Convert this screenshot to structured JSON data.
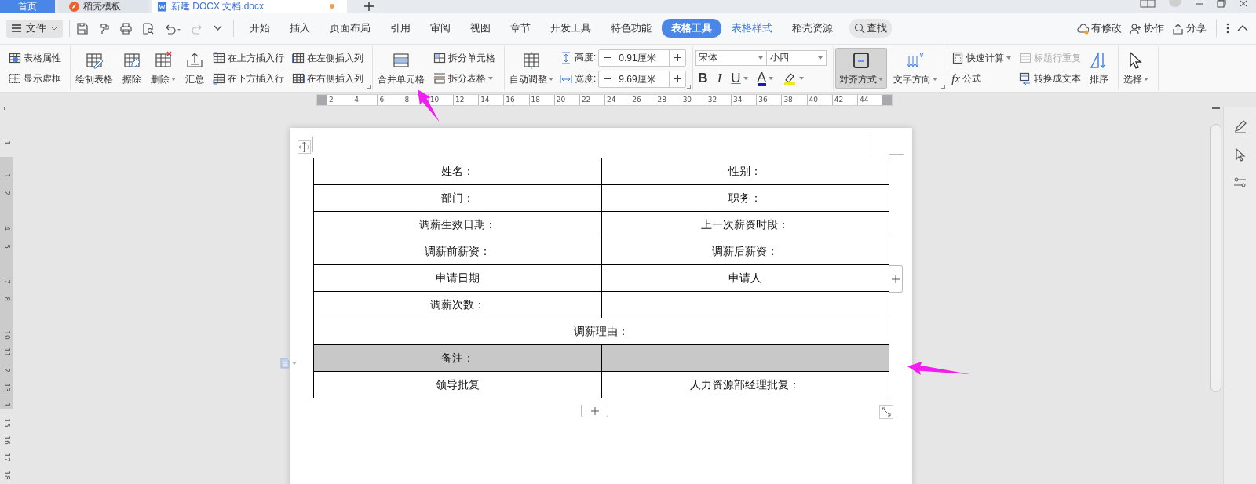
{
  "tabs": [
    {
      "label": "首页",
      "kind": "home",
      "selected": false,
      "modified": false
    },
    {
      "label": "稻壳模板",
      "kind": "template",
      "selected": false,
      "modified": false
    },
    {
      "label": "新建 DOCX 文档.docx",
      "kind": "document",
      "selected": true,
      "modified": true
    }
  ],
  "menu": {
    "file_button": "文件",
    "tabs": [
      {
        "label": "开始",
        "selected": false,
        "contextual": false
      },
      {
        "label": "插入",
        "selected": false,
        "contextual": false
      },
      {
        "label": "页面布局",
        "selected": false,
        "contextual": false
      },
      {
        "label": "引用",
        "selected": false,
        "contextual": false
      },
      {
        "label": "审阅",
        "selected": false,
        "contextual": false
      },
      {
        "label": "视图",
        "selected": false,
        "contextual": false
      },
      {
        "label": "章节",
        "selected": false,
        "contextual": false
      },
      {
        "label": "开发工具",
        "selected": false,
        "contextual": false
      },
      {
        "label": "特色功能",
        "selected": false,
        "contextual": false
      },
      {
        "label": "表格工具",
        "selected": true,
        "contextual": true
      },
      {
        "label": "表格样式",
        "selected": false,
        "contextual": true
      },
      {
        "label": "稻壳资源",
        "selected": false,
        "contextual": false
      }
    ],
    "search": "查找",
    "actions": [
      "有修改",
      "协作",
      "分享"
    ]
  },
  "ribbon": [
    {
      "launcher": false,
      "columns": [
        {
          "kind": "stack",
          "items": [
            {
              "label": "表格属性",
              "dropdown": false,
              "disabled": false
            },
            {
              "label": "显示虚框",
              "dropdown": false,
              "disabled": false
            }
          ]
        }
      ]
    },
    {
      "launcher": true,
      "columns": [
        {
          "kind": "large",
          "label": "绘制表格",
          "dropdown": false,
          "pressed": false
        },
        {
          "kind": "large",
          "label": "擦除",
          "dropdown": false,
          "pressed": false
        },
        {
          "kind": "large",
          "label": "删除",
          "dropdown": true,
          "pressed": false
        },
        {
          "kind": "large",
          "label": "汇总",
          "dropdown": false,
          "pressed": false
        },
        {
          "kind": "stack",
          "items": [
            {
              "label": "在上方插入行",
              "dropdown": false,
              "disabled": false
            },
            {
              "label": "在下方插入行",
              "dropdown": false,
              "disabled": false
            }
          ]
        },
        {
          "kind": "stack",
          "items": [
            {
              "label": "在左侧插入列",
              "dropdown": false,
              "disabled": false
            },
            {
              "label": "在右侧插入列",
              "dropdown": false,
              "disabled": false
            }
          ]
        }
      ]
    },
    {
      "launcher": false,
      "columns": [
        {
          "kind": "large",
          "label": "合并单元格",
          "dropdown": false,
          "pressed": false
        },
        {
          "kind": "stack",
          "items": [
            {
              "label": "拆分单元格",
              "dropdown": false,
              "disabled": false
            },
            {
              "label": "拆分表格",
              "dropdown": true,
              "disabled": false
            }
          ]
        }
      ]
    },
    {
      "launcher": true,
      "columns": [
        {
          "kind": "large",
          "label": "自动调整",
          "dropdown": true,
          "pressed": false
        },
        {
          "kind": "spinner",
          "items": [
            {
              "label": "高度:",
              "value": "0.91厘米"
            },
            {
              "label": "宽度:",
              "value": "9.69厘米"
            }
          ]
        }
      ]
    },
    {
      "launcher": false,
      "columns": [
        {
          "kind": "font",
          "font": "宋体",
          "size": "小四",
          "formats": [
            {
              "label": "B",
              "kind": "bold",
              "dropdown": false
            },
            {
              "label": "I",
              "kind": "italic",
              "dropdown": false
            },
            {
              "label": "U",
              "kind": "underline",
              "dropdown": true
            },
            {
              "label": "A",
              "kind": "color",
              "dropdown": true,
              "color": "#1c1ca8"
            },
            {
              "kind": "highlight",
              "dropdown": true,
              "color": "#f5e61a"
            }
          ]
        }
      ]
    },
    {
      "launcher": true,
      "columns": [
        {
          "kind": "large",
          "label": "对齐方式",
          "dropdown": true,
          "pressed": true
        },
        {
          "kind": "large",
          "label": "文字方向",
          "dropdown": true,
          "pressed": false
        }
      ]
    },
    {
      "launcher": false,
      "columns": [
        {
          "kind": "stack",
          "items": [
            {
              "label": "快速计算",
              "dropdown": true,
              "disabled": false
            },
            {
              "label": "公式",
              "symbol": "fx",
              "dropdown": false,
              "disabled": false
            }
          ]
        },
        {
          "kind": "stack",
          "items": [
            {
              "label": "标题行重复",
              "dropdown": false,
              "disabled": true
            },
            {
              "label": "转换成文本",
              "dropdown": false,
              "disabled": false
            }
          ]
        },
        {
          "kind": "large",
          "label": "排序",
          "dropdown": false,
          "pressed": false
        }
      ]
    },
    {
      "launcher": false,
      "columns": [
        {
          "kind": "large",
          "label": "选择",
          "dropdown": true,
          "pressed": false
        }
      ]
    }
  ],
  "ruler": [
    "2",
    "4",
    "6",
    "8",
    "10",
    "12",
    "14",
    "16",
    "18",
    "20",
    "22",
    "24",
    "26",
    "28",
    "30",
    "32",
    "34",
    "36",
    "38",
    "40",
    "42",
    "44"
  ],
  "vertical_ruler": [
    {
      "label": "1",
      "gap": false
    },
    {
      "label": "1",
      "gap": false
    },
    {
      "label": "2",
      "gap": false
    },
    {
      "label": "4",
      "gap": true
    },
    {
      "label": "5",
      "gap": false
    },
    {
      "label": "7",
      "gap": true
    },
    {
      "label": "8",
      "gap": false
    },
    {
      "label": "10",
      "gap": true
    },
    {
      "label": "11",
      "gap": false
    },
    {
      "label": "2",
      "gap": false
    },
    {
      "label": "13",
      "gap": false
    },
    {
      "label": "1",
      "gap": false
    },
    {
      "label": "15",
      "gap": false
    },
    {
      "label": "16",
      "gap": false
    },
    {
      "label": "17",
      "gap": false
    },
    {
      "label": "18",
      "gap": false
    }
  ],
  "table": {
    "rows": [
      {
        "cells": [
          "姓名：",
          "性别："
        ],
        "selected": false
      },
      {
        "cells": [
          "部门：",
          "职务："
        ],
        "selected": false
      },
      {
        "cells": [
          "调薪生效日期：",
          "上一次薪资时段："
        ],
        "selected": false
      },
      {
        "cells": [
          "调薪前薪资：",
          "调薪后薪资："
        ],
        "selected": false
      },
      {
        "cells": [
          "申请日期",
          "申请人"
        ],
        "selected": false
      },
      {
        "cells": [
          "调薪次数：",
          null
        ],
        "selected": false
      },
      {
        "cells": [
          {
            "text": "调薪理由：",
            "colspan": 2
          }
        ],
        "selected": false
      },
      {
        "cells": [
          "备注：",
          null
        ],
        "selected": true
      },
      {
        "cells": [
          "领导批复",
          "人力资源部经理批复："
        ],
        "selected": false
      }
    ]
  },
  "annotation_arrows": [
    {
      "kind": "up-left"
    },
    {
      "kind": "left"
    }
  ]
}
